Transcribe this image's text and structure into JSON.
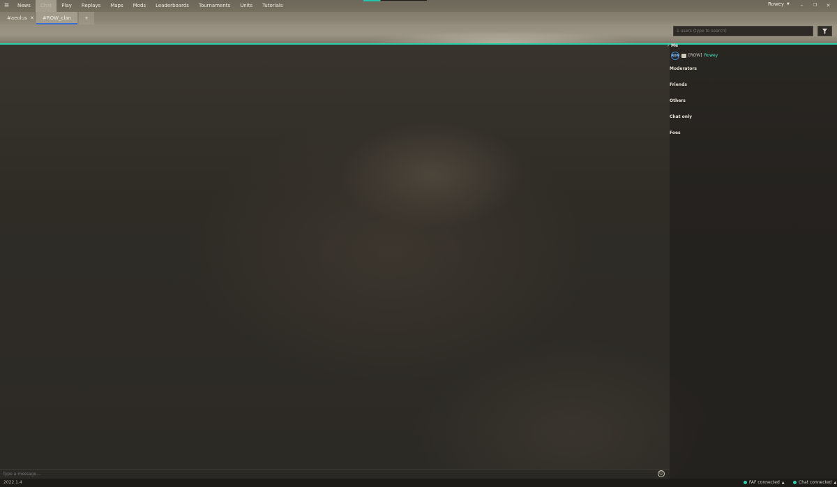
{
  "nav": {
    "menu_icon": "hamburger-icon",
    "items": [
      "News",
      "Chat",
      "Play",
      "Replays",
      "Maps",
      "Mods",
      "Leaderboards",
      "Tournaments",
      "Units",
      "Tutorials"
    ],
    "active": "Chat"
  },
  "user_menu": {
    "name": "Rowey",
    "caret": "▼"
  },
  "window": {
    "minimize": "–",
    "restore": "❐",
    "close": "✕"
  },
  "tabs": {
    "aeolus": "#aeolus",
    "aeolus_close": "✕",
    "clan": "#ROW_clan",
    "add": "+"
  },
  "search": {
    "placeholder": "1 users (type to search)"
  },
  "user_list": {
    "categories": {
      "me": "Me",
      "moderators": "Moderators",
      "friends": "Friends",
      "others": "Others",
      "chat_only": "Chat only",
      "foes": "Foes"
    },
    "me_user": {
      "avatar": "ROW",
      "clan": "[ROW]",
      "name": "Rowey"
    }
  },
  "message": {
    "placeholder": "Type a message..."
  },
  "status": {
    "version": "2022.1.4",
    "faf": "FAF connected",
    "chat": "Chat connected",
    "caret": "▲"
  },
  "colors": {
    "accent": "#2bd1ad",
    "tab_underline": "#3a6ed0"
  }
}
